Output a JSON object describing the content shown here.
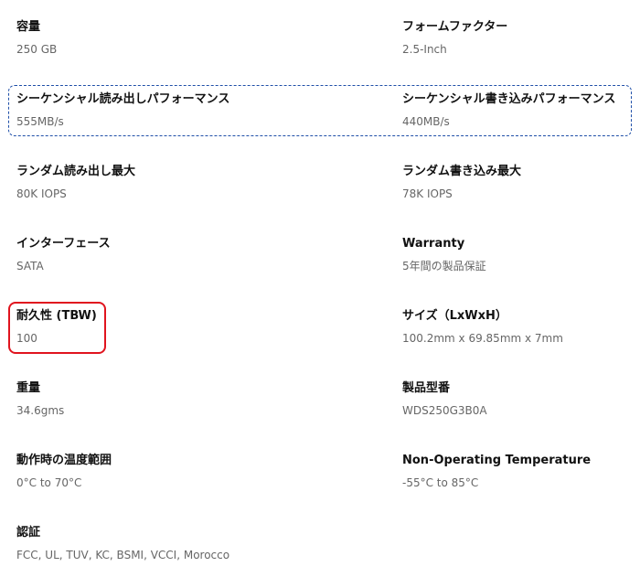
{
  "specs": [
    {
      "label": "容量",
      "value": "250 GB"
    },
    {
      "label": "フォームファクター",
      "value": "2.5-Inch"
    },
    {
      "label": "シーケンシャル読み出しパフォーマンス",
      "value": "555MB/s"
    },
    {
      "label": "シーケンシャル書き込みパフォーマンス",
      "value": "440MB/s"
    },
    {
      "label": "ランダム読み出し最大",
      "value": "80K IOPS"
    },
    {
      "label": "ランダム書き込み最大",
      "value": "78K IOPS"
    },
    {
      "label": "インターフェース",
      "value": "SATA"
    },
    {
      "label": "Warranty",
      "value": "5年間の製品保証"
    },
    {
      "label": "耐久性 (TBW)",
      "value": "100"
    },
    {
      "label": "サイズ（LxWxH）",
      "value": "100.2mm x 69.85mm x 7mm"
    },
    {
      "label": "重量",
      "value": "34.6gms"
    },
    {
      "label": "製品型番",
      "value": "WDS250G3B0A"
    },
    {
      "label": "動作時の温度範囲",
      "value": "0°C to 70°C"
    },
    {
      "label": "Non-Operating Temperature",
      "value": "-55°C to 85°C"
    },
    {
      "label": "認証",
      "value": "FCC, UL, TUV, KC, BSMI, VCCI, Morocco"
    }
  ],
  "highlights": {
    "dashed_color": "#1f4fa8",
    "red_color": "#e0141e"
  }
}
